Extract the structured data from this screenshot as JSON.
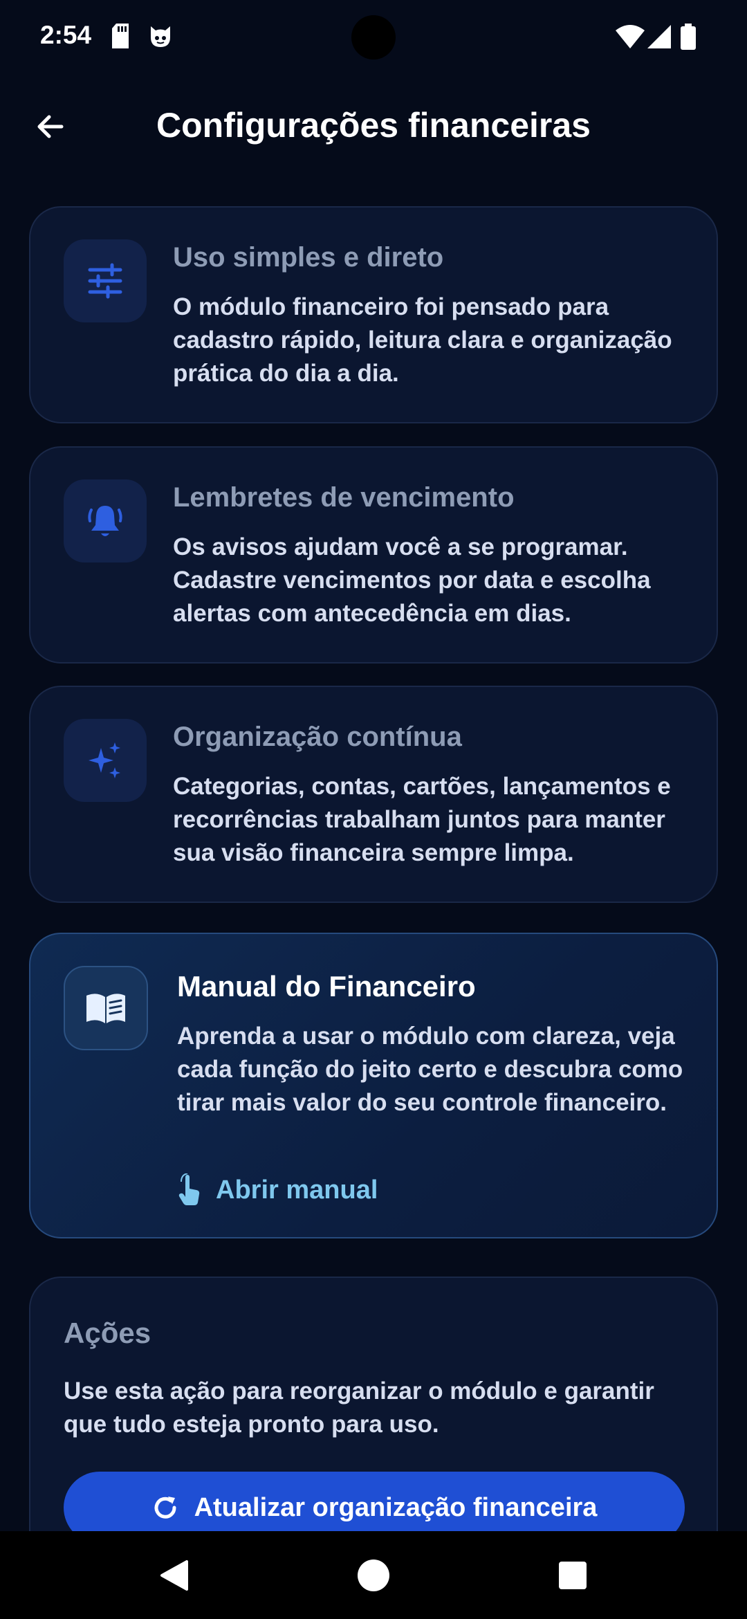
{
  "status_bar": {
    "time": "2:54",
    "left_icons": [
      "sd-card-icon",
      "cat-notification-icon"
    ],
    "right_icons": [
      "wifi-icon",
      "signal-icon",
      "battery-icon"
    ]
  },
  "app_bar": {
    "title": "Configurações financeiras",
    "back_icon": "arrow-left-icon"
  },
  "cards": [
    {
      "icon": "sliders-icon",
      "title": "Uso simples e direto",
      "text": "O módulo financeiro foi pensado para cadastro rápido, leitura clara e organização prática do dia a dia."
    },
    {
      "icon": "bell-ringing-icon",
      "title": "Lembretes de vencimento",
      "text": "Os avisos ajudam você a se programar. Cadastre vencimentos por data e escolha alertas com antecedência em dias."
    },
    {
      "icon": "sparkles-icon",
      "title": "Organização contínua",
      "text": "Categorias, contas, cartões, lançamentos e recorrências trabalham juntos para manter sua visão financeira sempre limpa."
    }
  ],
  "manual": {
    "icon": "book-open-icon",
    "title": "Manual do Financeiro",
    "text": "Aprenda a usar o módulo com clareza, veja cada função do jeito certo e descubra como tirar mais valor do seu controle financeiro.",
    "link_icon": "tap-hand-icon",
    "link_label": "Abrir manual"
  },
  "actions": {
    "title": "Ações",
    "text": "Use esta ação para reorganizar o módulo e garantir que tudo esteja pronto para uso.",
    "button_icon": "refresh-icon",
    "button_label": "Atualizar organização financeira"
  },
  "colors": {
    "background": "#050b1a",
    "card": "#0b1630",
    "accent_blue": "#1f4fd4",
    "icon_blue": "#2e5fe0",
    "link_cyan": "#7fc8ee"
  }
}
